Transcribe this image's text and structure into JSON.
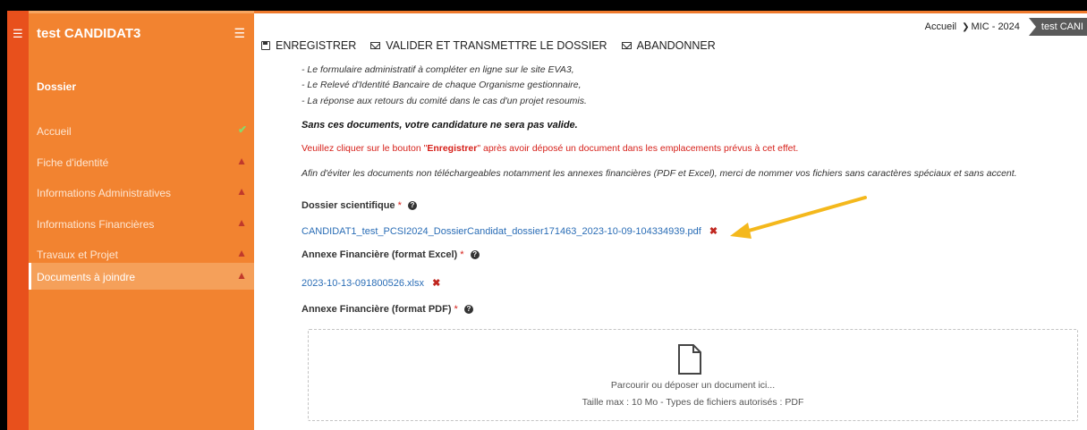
{
  "sidebar": {
    "title": "test CANDIDAT3",
    "section": "Dossier",
    "items": [
      {
        "label": "Accueil",
        "status": "✔",
        "kind": "ok"
      },
      {
        "label": "Fiche d'identité",
        "status": "▲",
        "kind": "warn"
      },
      {
        "label": "Informations Administratives",
        "status": "▲",
        "kind": "warn"
      },
      {
        "label": "Informations Financières",
        "status": "▲",
        "kind": "warn"
      },
      {
        "label": "Travaux et Projet",
        "status": "▲",
        "kind": "warn"
      },
      {
        "label": "Documents à joindre",
        "status": "▲",
        "kind": "warn",
        "active": true
      }
    ]
  },
  "breadcrumb": {
    "home": "Accueil",
    "level2": "MIC - 2024",
    "level3": "test CANI"
  },
  "toolbar": {
    "save_label": "ENREGISTRER",
    "validate_label": "VALIDER ET TRANSMETTRE LE DOSSIER",
    "abandon_label": "ABANDONNER"
  },
  "content": {
    "line1": "- Le formulaire administratif à compléter en ligne sur le site EVA3,",
    "line2": "- Le Relevé d'Identité Bancaire de chaque Organisme gestionnaire,",
    "line3": "- La réponse aux retours du comité dans le cas d'un projet resoumis.",
    "warning_bold": "Sans ces documents, votre candidature ne sera pas valide.",
    "red_prefix": "Veuillez cliquer sur le bouton \"",
    "red_bold": "Enregistrer",
    "red_suffix": "\" après avoir déposé un document dans les emplacements prévus à cet effet.",
    "advice": "Afin d'éviter les documents non téléchargeables notamment les annexes financières (PDF et Excel), merci de nommer vos fichiers sans caractères spéciaux et sans accent."
  },
  "fields": {
    "dossier_label": "Dossier scientifique",
    "dossier_file": "CANDIDAT1_test_PCSI2024_DossierCandidat_dossier171463_2023-10-09-104334939.pdf",
    "excel_label": "Annexe Financière (format Excel)",
    "excel_file": "2023-10-13-091800526.xlsx",
    "pdf_label": "Annexe Financière (format PDF)",
    "required_mark": "*",
    "help": "?",
    "delete": "✖"
  },
  "dropzone": {
    "text": "Parcourir ou déposer un document ici...",
    "hint": "Taille max : 10 Mo - Types de fichiers autorisés : PDF"
  },
  "colors": {
    "rail": "#e8501c",
    "sidebar": "#f28330",
    "link": "#2a6db6",
    "arrow": "#f4b81c",
    "delete": "#c0261f"
  }
}
